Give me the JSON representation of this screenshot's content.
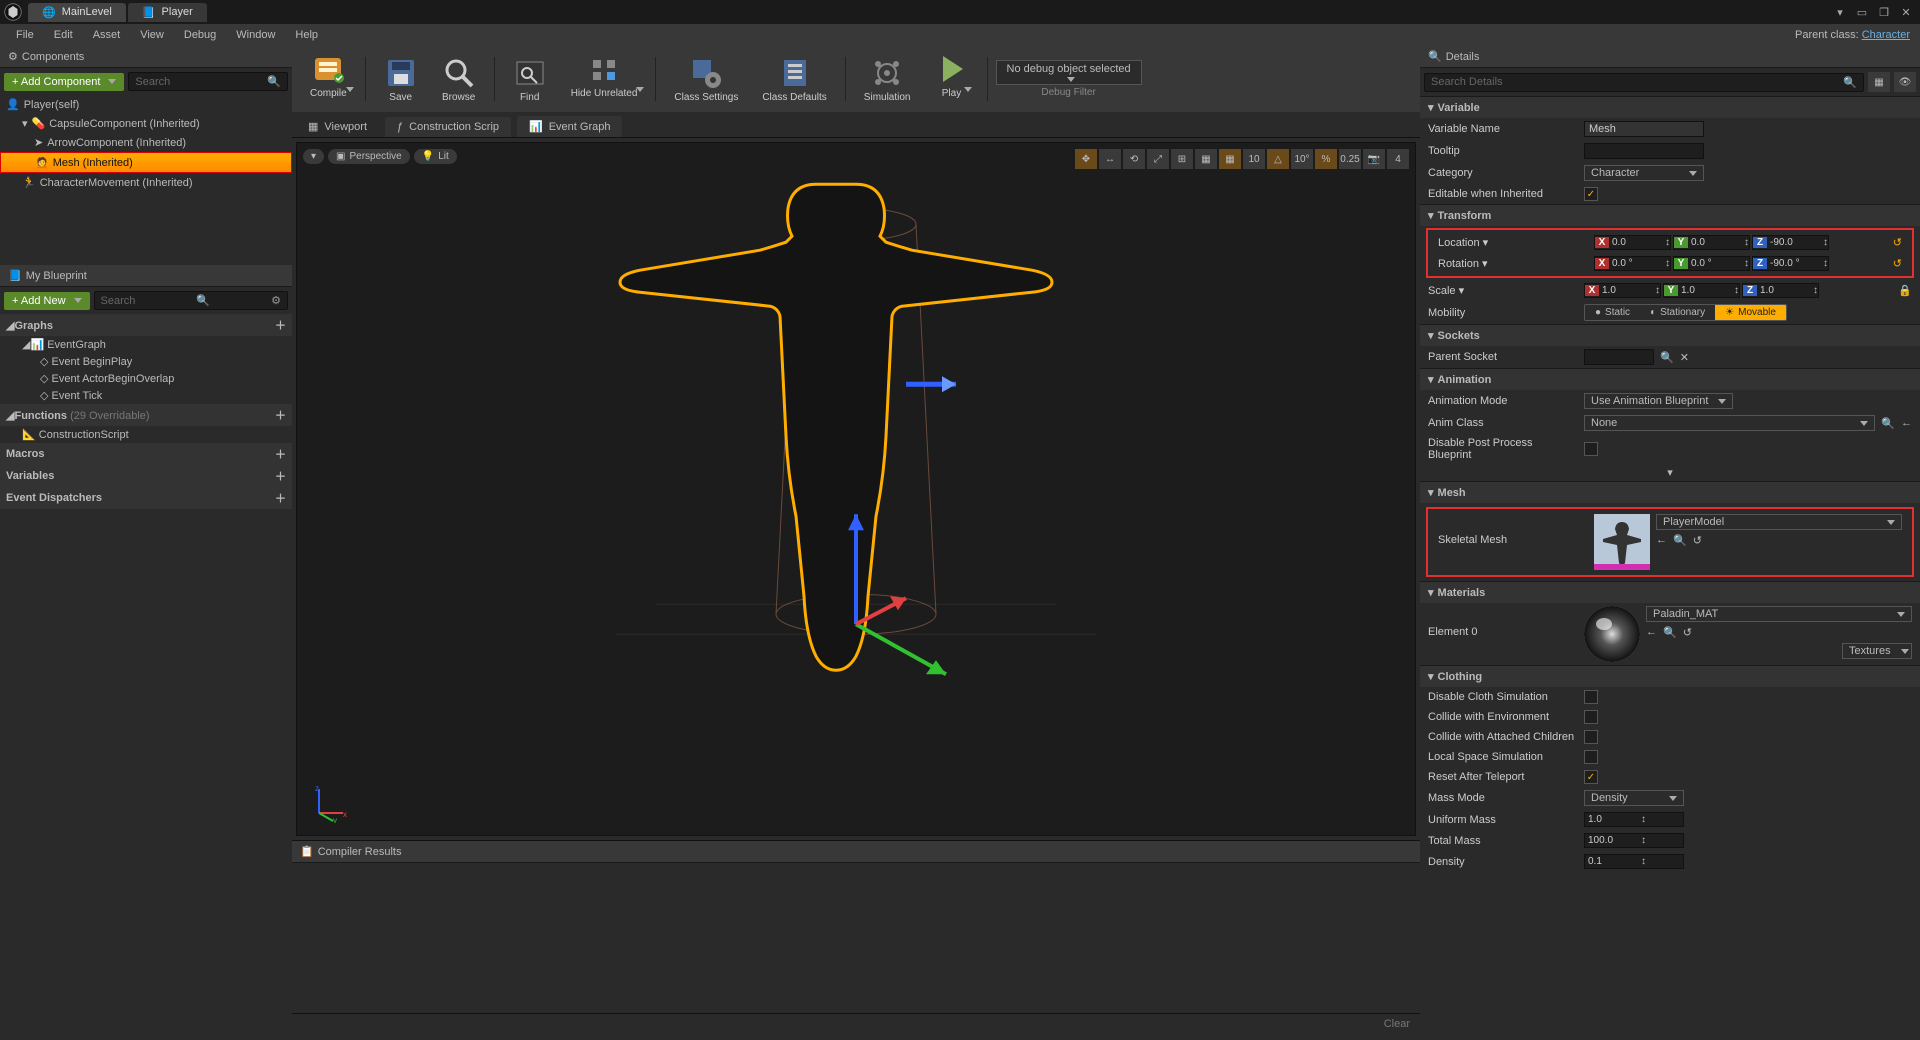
{
  "title": {
    "tab1": "MainLevel",
    "tab2": "Player"
  },
  "parentClass": {
    "label": "Parent class:",
    "value": "Character"
  },
  "menus": [
    "File",
    "Edit",
    "Asset",
    "View",
    "Debug",
    "Window",
    "Help"
  ],
  "components": {
    "panel": "Components",
    "addBtn": "+ Add Component",
    "searchPlaceholder": "Search",
    "items": [
      {
        "label": "Player(self)",
        "depth": 0
      },
      {
        "label": "CapsuleComponent (Inherited)",
        "depth": 1
      },
      {
        "label": "ArrowComponent (Inherited)",
        "depth": 2
      },
      {
        "label": "Mesh (Inherited)",
        "depth": 2,
        "sel": true
      },
      {
        "label": "CharacterMovement (Inherited)",
        "depth": 1
      }
    ]
  },
  "myBlueprint": {
    "panel": "My Blueprint",
    "addBtn": "+ Add New",
    "searchPlaceholder": "Search",
    "sections": [
      {
        "name": "Graphs",
        "items": [
          "EventGraph",
          "Event BeginPlay",
          "Event ActorBeginOverlap",
          "Event Tick"
        ]
      },
      {
        "name": "Functions",
        "suffix": "(29 Overridable)",
        "items": [
          "ConstructionScript"
        ]
      },
      {
        "name": "Macros",
        "items": []
      },
      {
        "name": "Variables",
        "items": []
      },
      {
        "name": "Event Dispatchers",
        "items": []
      }
    ]
  },
  "toolbar": {
    "buttons": [
      "Compile",
      "Save",
      "Browse",
      "Find",
      "Hide Unrelated",
      "Class Settings",
      "Class Defaults",
      "Simulation",
      "Play"
    ],
    "debugCombo": "No debug object selected",
    "debugFilter": "Debug Filter"
  },
  "editorTabs": [
    "Viewport",
    "Construction Scrip",
    "Event Graph"
  ],
  "vp": {
    "mode": "Perspective",
    "lit": "Lit",
    "grid": "10",
    "angle": "10°",
    "scale": "0.25",
    "cam": "4"
  },
  "compilerResults": "Compiler Results",
  "clear": "Clear",
  "details": {
    "panel": "Details",
    "searchPlaceholder": "Search Details",
    "variable": {
      "section": "Variable",
      "name": "Variable Name",
      "nameVal": "Mesh",
      "tooltip": "Tooltip",
      "category": "Category",
      "categoryVal": "Character",
      "editable": "Editable when Inherited"
    },
    "transform": {
      "section": "Transform",
      "location": "Location",
      "rotation": "Rotation",
      "scale": "Scale",
      "mobility": "Mobility",
      "loc": {
        "x": "0.0",
        "y": "0.0",
        "z": "-90.0"
      },
      "rot": {
        "x": "0.0 °",
        "y": "0.0 °",
        "z": "-90.0 °"
      },
      "scl": {
        "x": "1.0",
        "y": "1.0",
        "z": "1.0"
      },
      "mobOpts": [
        "Static",
        "Stationary",
        "Movable"
      ]
    },
    "sockets": {
      "section": "Sockets",
      "parent": "Parent Socket"
    },
    "animation": {
      "section": "Animation",
      "mode": "Animation Mode",
      "modeVal": "Use Animation Blueprint",
      "class": "Anim Class",
      "classVal": "None",
      "disablePP": "Disable Post Process Blueprint"
    },
    "mesh": {
      "section": "Mesh",
      "skeletal": "Skeletal Mesh",
      "asset": "PlayerModel"
    },
    "materials": {
      "section": "Materials",
      "element": "Element 0",
      "asset": "Paladin_MAT",
      "textures": "Textures"
    },
    "clothing": {
      "section": "Clothing",
      "disable": "Disable Cloth Simulation",
      "collideEnv": "Collide with Environment",
      "collideChild": "Collide with Attached Children",
      "localSim": "Local Space Simulation",
      "resetTp": "Reset After Teleport",
      "massMode": "Mass Mode",
      "massModeVal": "Density",
      "uniformMass": "Uniform Mass",
      "uniformMassVal": "1.0",
      "totalMass": "Total Mass",
      "totalMassVal": "100.0",
      "density": "Density",
      "densityVal": "0.1"
    }
  }
}
